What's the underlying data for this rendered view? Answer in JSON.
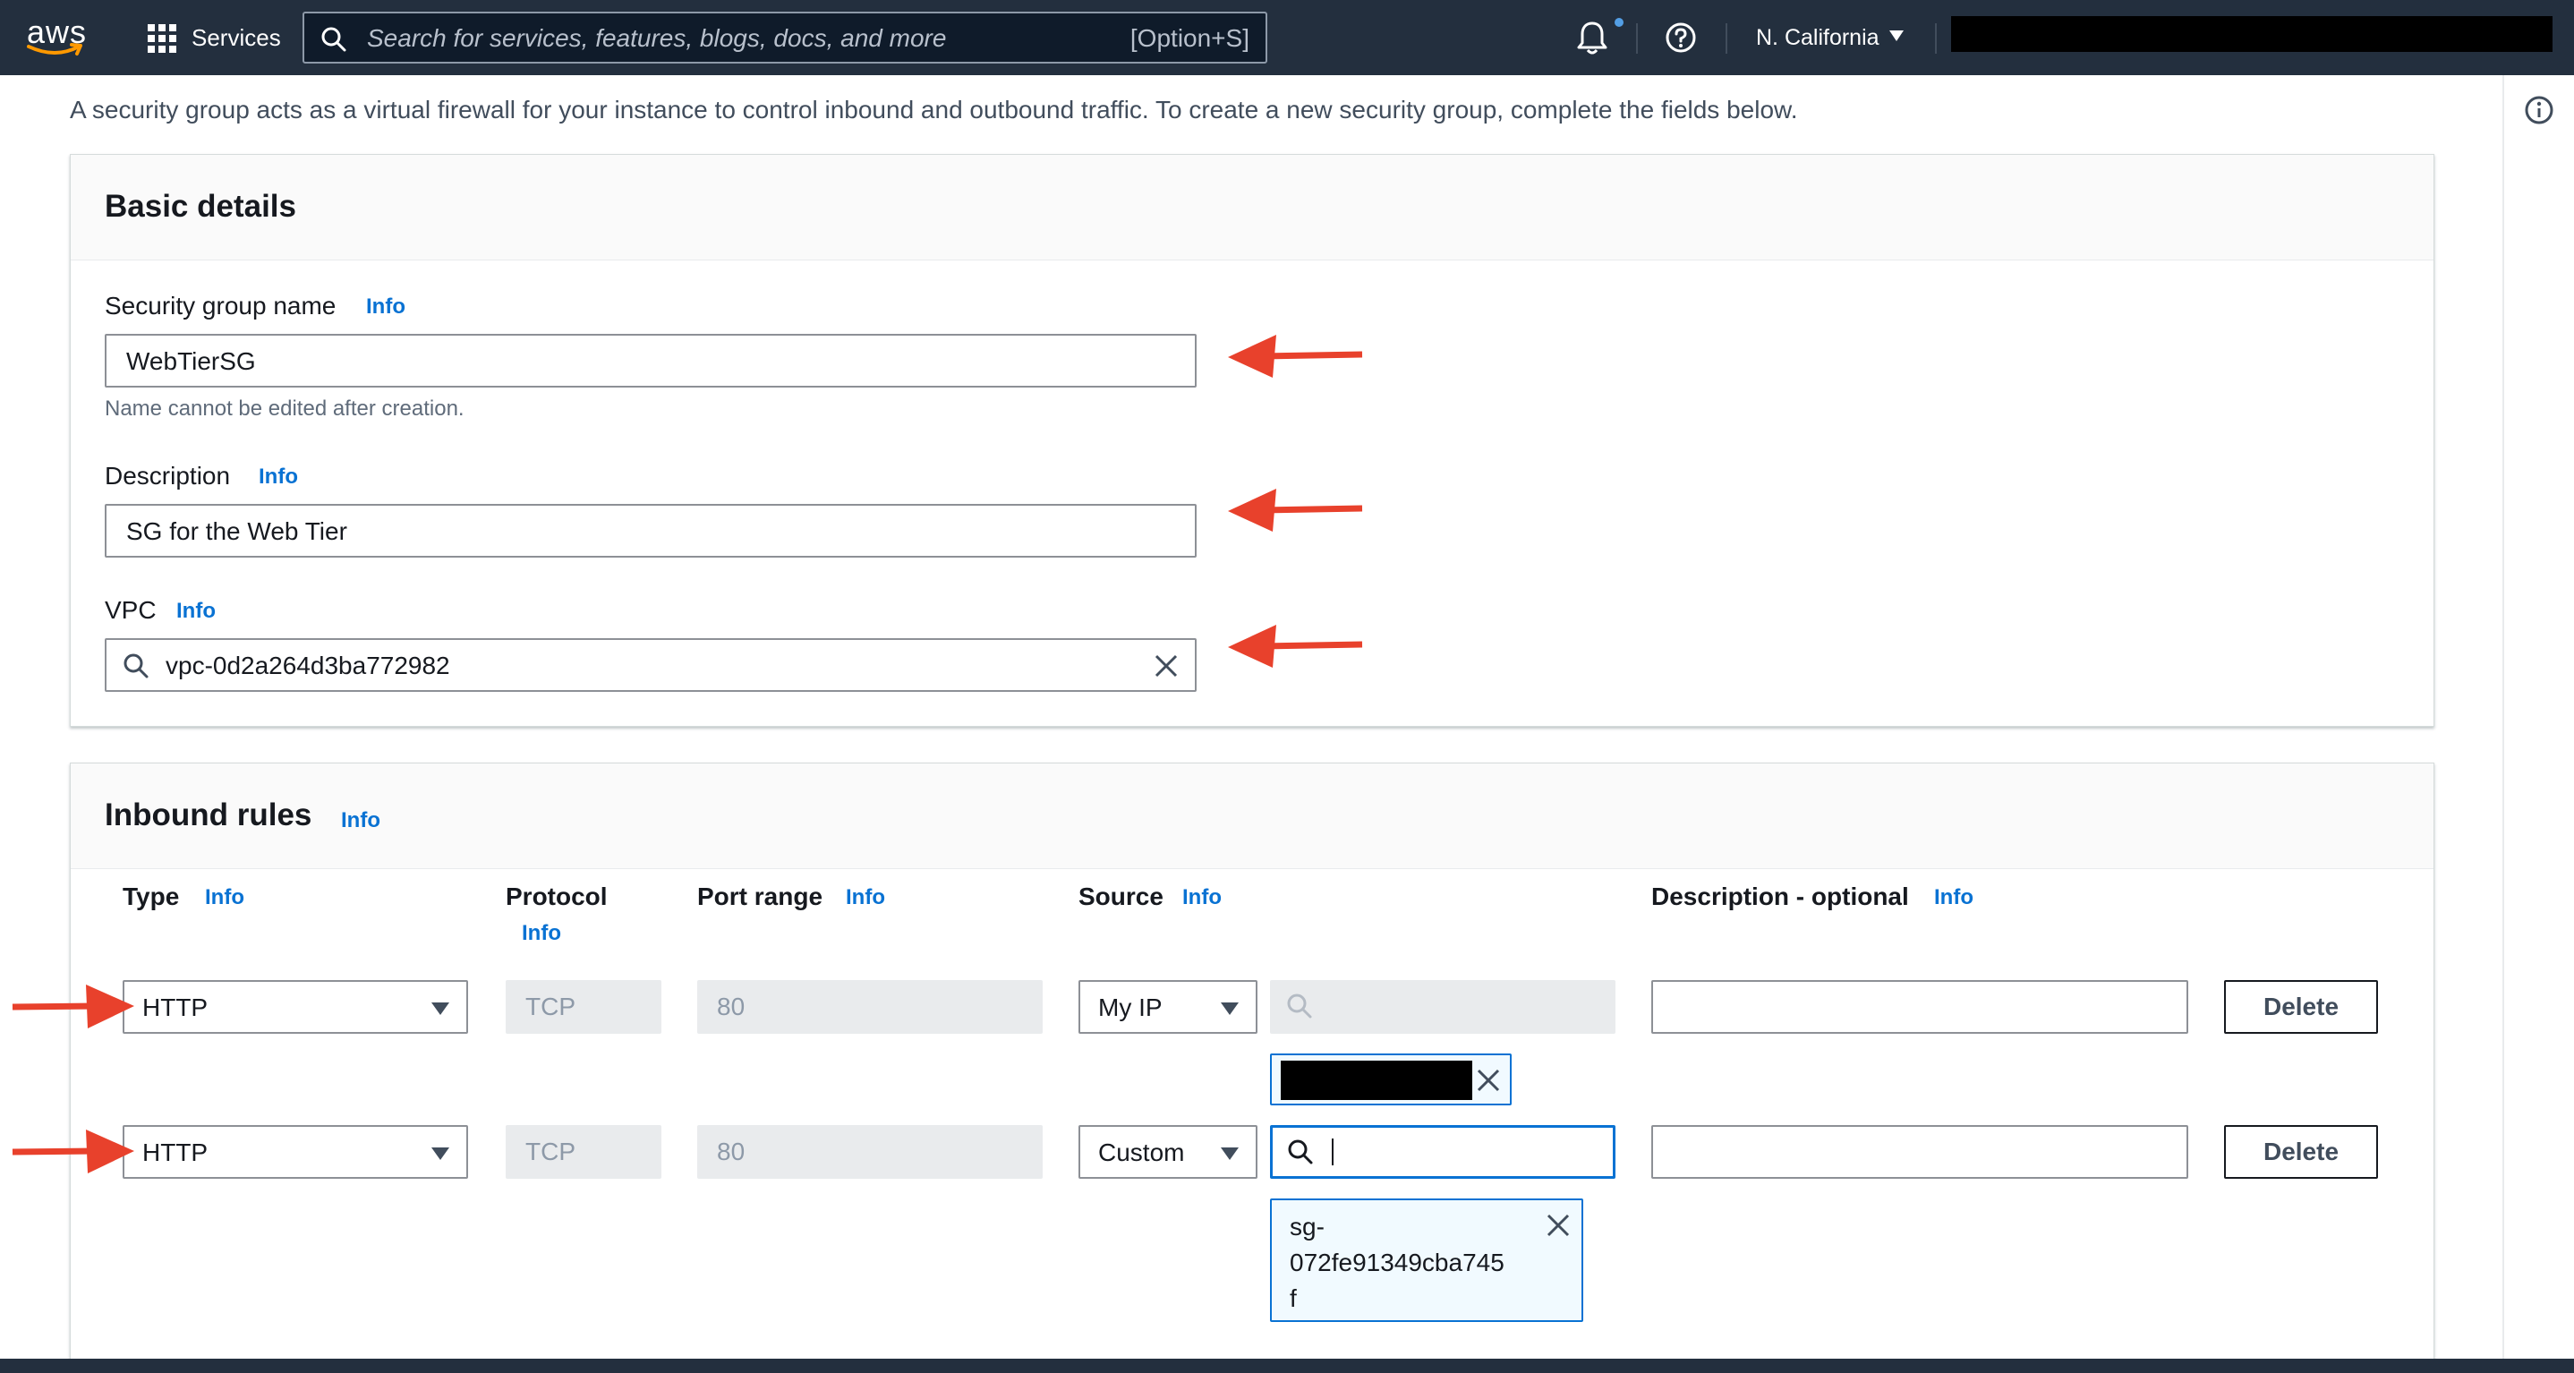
{
  "nav": {
    "logo_text": "aws",
    "services_label": "Services",
    "search_placeholder": "Search for services, features, blogs, docs, and more",
    "search_shortcut": "[Option+S]",
    "region": "N. California",
    "icons": [
      "grid-icon",
      "search-icon",
      "bell-icon",
      "help-icon",
      "caret-down-icon"
    ]
  },
  "intro_text": "A security group acts as a virtual firewall for your instance to control inbound and outbound traffic. To create a new security group, complete the fields below.",
  "basic_details": {
    "title": "Basic details",
    "name_label": "Security group name",
    "name_info": "Info",
    "name_value": "WebTierSG",
    "name_hint": "Name cannot be edited after creation.",
    "desc_label": "Description",
    "desc_info": "Info",
    "desc_value": "SG for the Web Tier",
    "vpc_label": "VPC",
    "vpc_info": "Info",
    "vpc_value": "vpc-0d2a264d3ba772982"
  },
  "inbound_rules": {
    "title": "Inbound rules",
    "title_info": "Info",
    "columns": {
      "type": "Type",
      "type_info": "Info",
      "protocol": "Protocol",
      "protocol_info": "Info",
      "port_range": "Port range",
      "port_info": "Info",
      "source": "Source",
      "source_info": "Info",
      "description": "Description - optional",
      "description_info": "Info"
    },
    "rows": [
      {
        "type": "HTTP",
        "protocol": "TCP",
        "port_range": "80",
        "source": "My IP",
        "source_input": "",
        "description": "",
        "delete_label": "Delete"
      },
      {
        "type": "HTTP",
        "protocol": "TCP",
        "port_range": "80",
        "source": "Custom",
        "source_input": "",
        "token_lines": [
          "sg-",
          "072fe91349cba745",
          "f"
        ],
        "description": "",
        "delete_label": "Delete"
      }
    ]
  },
  "colors": {
    "nav_bg": "#232f3e",
    "link_blue": "#0972d3",
    "annotation_arrow": "#e8412c",
    "token_bg": "#f1faff"
  }
}
